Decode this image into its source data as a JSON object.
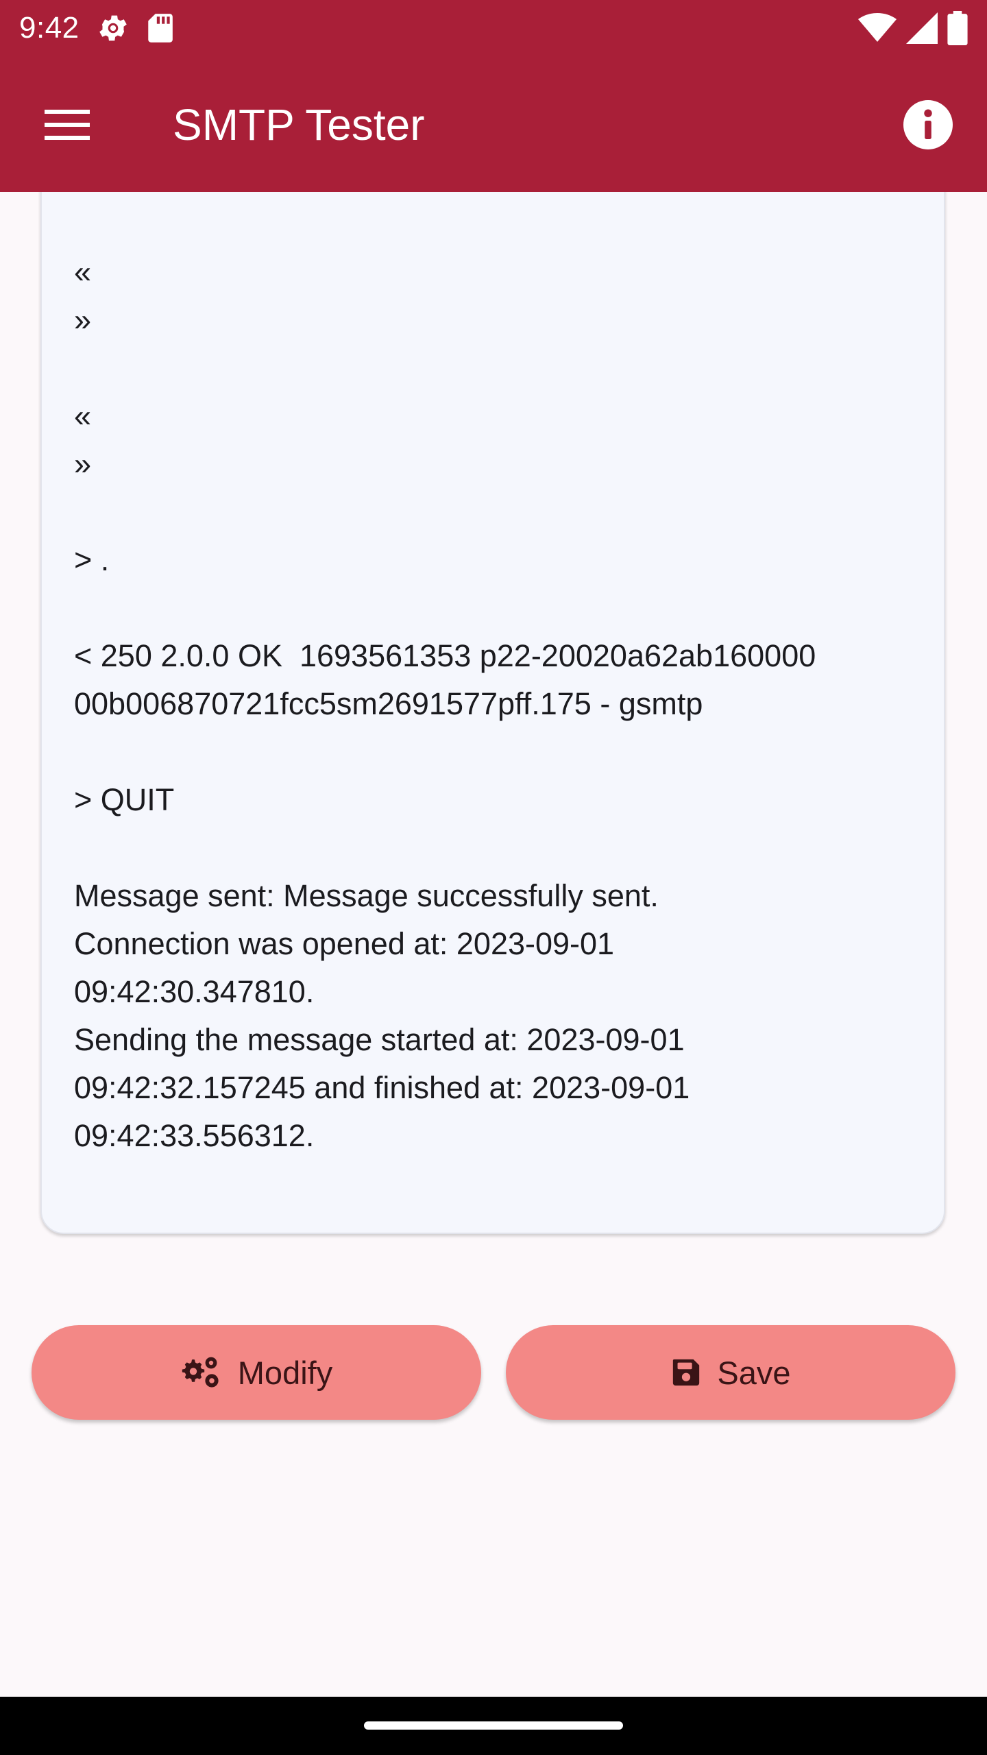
{
  "status_bar": {
    "time": "9:42",
    "icons": [
      "settings-gear-icon",
      "sd-card-icon",
      "wifi-icon",
      "cellular-signal-icon",
      "battery-icon"
    ]
  },
  "app_bar": {
    "title": "SMTP Tester",
    "menu_icon": "hamburger-menu-icon",
    "info_icon": "info-icon",
    "background": "#a91f38"
  },
  "log": {
    "text": "«\n»\n\n«\n»\n\n> .\n\n< 250 2.0.0 OK  1693561353 p22-20020a62ab160000\n00b006870721fcc5sm2691577pff.175 - gsmtp\n\n> QUIT\n\nMessage sent: Message successfully sent.\nConnection was opened at: 2023-09-01\n09:42:30.347810.\nSending the message started at: 2023-09-01\n09:42:32.157245 and finished at: 2023-09-01\n09:42:33.556312."
  },
  "actions": {
    "modify_label": "Modify",
    "modify_icon": "gears-icon",
    "save_label": "Save",
    "save_icon": "floppy-disk-icon",
    "button_color": "#f38886"
  }
}
